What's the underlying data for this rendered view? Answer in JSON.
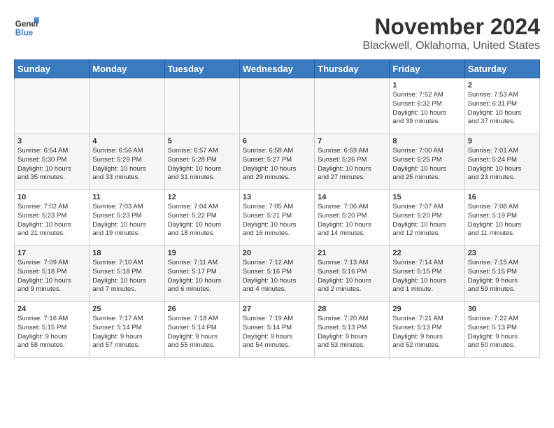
{
  "header": {
    "logo_line1": "General",
    "logo_line2": "Blue",
    "month": "November 2024",
    "location": "Blackwell, Oklahoma, United States"
  },
  "weekdays": [
    "Sunday",
    "Monday",
    "Tuesday",
    "Wednesday",
    "Thursday",
    "Friday",
    "Saturday"
  ],
  "weeks": [
    [
      {
        "day": "",
        "info": ""
      },
      {
        "day": "",
        "info": ""
      },
      {
        "day": "",
        "info": ""
      },
      {
        "day": "",
        "info": ""
      },
      {
        "day": "",
        "info": ""
      },
      {
        "day": "1",
        "info": "Sunrise: 7:52 AM\nSunset: 6:32 PM\nDaylight: 10 hours\nand 39 minutes."
      },
      {
        "day": "2",
        "info": "Sunrise: 7:53 AM\nSunset: 6:31 PM\nDaylight: 10 hours\nand 37 minutes."
      }
    ],
    [
      {
        "day": "3",
        "info": "Sunrise: 6:54 AM\nSunset: 5:30 PM\nDaylight: 10 hours\nand 35 minutes."
      },
      {
        "day": "4",
        "info": "Sunrise: 6:56 AM\nSunset: 5:29 PM\nDaylight: 10 hours\nand 33 minutes."
      },
      {
        "day": "5",
        "info": "Sunrise: 6:57 AM\nSunset: 5:28 PM\nDaylight: 10 hours\nand 31 minutes."
      },
      {
        "day": "6",
        "info": "Sunrise: 6:58 AM\nSunset: 5:27 PM\nDaylight: 10 hours\nand 29 minutes."
      },
      {
        "day": "7",
        "info": "Sunrise: 6:59 AM\nSunset: 5:26 PM\nDaylight: 10 hours\nand 27 minutes."
      },
      {
        "day": "8",
        "info": "Sunrise: 7:00 AM\nSunset: 5:25 PM\nDaylight: 10 hours\nand 25 minutes."
      },
      {
        "day": "9",
        "info": "Sunrise: 7:01 AM\nSunset: 5:24 PM\nDaylight: 10 hours\nand 23 minutes."
      }
    ],
    [
      {
        "day": "10",
        "info": "Sunrise: 7:02 AM\nSunset: 5:23 PM\nDaylight: 10 hours\nand 21 minutes."
      },
      {
        "day": "11",
        "info": "Sunrise: 7:03 AM\nSunset: 5:23 PM\nDaylight: 10 hours\nand 19 minutes."
      },
      {
        "day": "12",
        "info": "Sunrise: 7:04 AM\nSunset: 5:22 PM\nDaylight: 10 hours\nand 18 minutes."
      },
      {
        "day": "13",
        "info": "Sunrise: 7:05 AM\nSunset: 5:21 PM\nDaylight: 10 hours\nand 16 minutes."
      },
      {
        "day": "14",
        "info": "Sunrise: 7:06 AM\nSunset: 5:20 PM\nDaylight: 10 hours\nand 14 minutes."
      },
      {
        "day": "15",
        "info": "Sunrise: 7:07 AM\nSunset: 5:20 PM\nDaylight: 10 hours\nand 12 minutes."
      },
      {
        "day": "16",
        "info": "Sunrise: 7:08 AM\nSunset: 5:19 PM\nDaylight: 10 hours\nand 11 minutes."
      }
    ],
    [
      {
        "day": "17",
        "info": "Sunrise: 7:09 AM\nSunset: 5:18 PM\nDaylight: 10 hours\nand 9 minutes."
      },
      {
        "day": "18",
        "info": "Sunrise: 7:10 AM\nSunset: 5:18 PM\nDaylight: 10 hours\nand 7 minutes."
      },
      {
        "day": "19",
        "info": "Sunrise: 7:11 AM\nSunset: 5:17 PM\nDaylight: 10 hours\nand 6 minutes."
      },
      {
        "day": "20",
        "info": "Sunrise: 7:12 AM\nSunset: 5:16 PM\nDaylight: 10 hours\nand 4 minutes."
      },
      {
        "day": "21",
        "info": "Sunrise: 7:13 AM\nSunset: 5:16 PM\nDaylight: 10 hours\nand 2 minutes."
      },
      {
        "day": "22",
        "info": "Sunrise: 7:14 AM\nSunset: 5:15 PM\nDaylight: 10 hours\nand 1 minute."
      },
      {
        "day": "23",
        "info": "Sunrise: 7:15 AM\nSunset: 5:15 PM\nDaylight: 9 hours\nand 59 minutes."
      }
    ],
    [
      {
        "day": "24",
        "info": "Sunrise: 7:16 AM\nSunset: 5:15 PM\nDaylight: 9 hours\nand 58 minutes."
      },
      {
        "day": "25",
        "info": "Sunrise: 7:17 AM\nSunset: 5:14 PM\nDaylight: 9 hours\nand 57 minutes."
      },
      {
        "day": "26",
        "info": "Sunrise: 7:18 AM\nSunset: 5:14 PM\nDaylight: 9 hours\nand 55 minutes."
      },
      {
        "day": "27",
        "info": "Sunrise: 7:19 AM\nSunset: 5:14 PM\nDaylight: 9 hours\nand 54 minutes."
      },
      {
        "day": "28",
        "info": "Sunrise: 7:20 AM\nSunset: 5:13 PM\nDaylight: 9 hours\nand 53 minutes."
      },
      {
        "day": "29",
        "info": "Sunrise: 7:21 AM\nSunset: 5:13 PM\nDaylight: 9 hours\nand 52 minutes."
      },
      {
        "day": "30",
        "info": "Sunrise: 7:22 AM\nSunset: 5:13 PM\nDaylight: 9 hours\nand 50 minutes."
      }
    ]
  ]
}
